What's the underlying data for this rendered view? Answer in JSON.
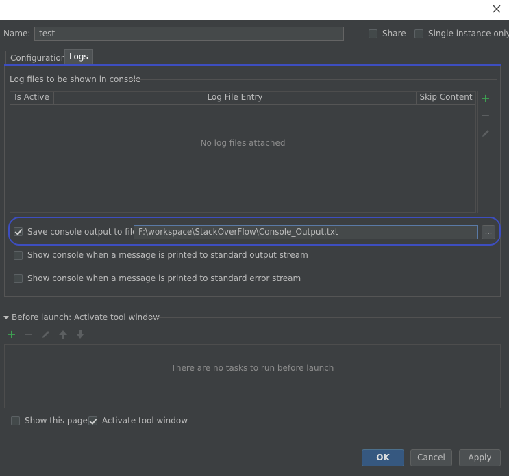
{
  "colors": {
    "accent": "#365880",
    "add_icon": "#3ea352",
    "highlight_ring": "#3d4ec0"
  },
  "header": {
    "name_label": "Name:",
    "name_value": "test",
    "share_label": "Share",
    "share_checked": false,
    "single_instance_label": "Single instance only",
    "single_instance_checked": false
  },
  "tabs": [
    {
      "label": "Configuration",
      "active": false
    },
    {
      "label": "Logs",
      "active": true
    }
  ],
  "logs": {
    "group_title": "Log files to be shown in console",
    "columns": [
      "Is Active",
      "Log File Entry",
      "Skip Content"
    ],
    "empty_text": "No log files attached",
    "toolbar_icons": [
      "add-icon",
      "remove-icon",
      "edit-icon"
    ]
  },
  "options": {
    "save_output_label": "Save console output to file:",
    "save_output_checked": true,
    "save_output_path": "F:\\workspace\\StackOverFlow\\Console_Output.txt",
    "browse_label": "...",
    "show_stdout_label": "Show console when a message is printed to standard output stream",
    "show_stdout_checked": false,
    "show_stderr_label": "Show console when a message is printed to standard error stream",
    "show_stderr_checked": false
  },
  "before_launch": {
    "title": "Before launch: Activate tool window",
    "empty_text": "There are no tasks to run before launch",
    "toolbar_icons": [
      "add-icon",
      "remove-icon",
      "edit-icon",
      "move-up-icon",
      "move-down-icon"
    ]
  },
  "footer": {
    "show_page_label": "Show this page",
    "show_page_checked": false,
    "activate_tool_label": "Activate tool window",
    "activate_tool_checked": true,
    "ok_label": "OK",
    "cancel_label": "Cancel",
    "apply_label": "Apply"
  }
}
